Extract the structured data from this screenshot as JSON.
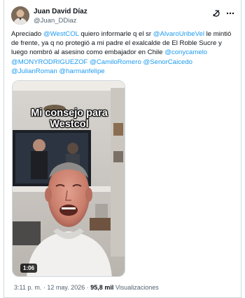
{
  "author": {
    "name": "Juan David Díaz",
    "handle": "@Juan_DDiaz"
  },
  "icons": {
    "grok": "grok-icon",
    "more": "more-options-icon"
  },
  "tweet": {
    "parts": [
      {
        "text": "Apreciado ",
        "link": false
      },
      {
        "text": "@WestCOL",
        "link": true
      },
      {
        "text": " quiero informarle q el sr ",
        "link": false
      },
      {
        "text": "@AlvaroUribeVel",
        "link": true
      },
      {
        "text": " le mintió de frente, ya q no protegió a mi padre el exalcalde de El Roble Sucre y luego nombró al asesino como  embajador en Chile ",
        "link": false
      },
      {
        "text": "@conycamelo",
        "link": true
      },
      {
        "text": " ",
        "link": false
      },
      {
        "text": "@MONYRODRIGUEZOF",
        "link": true
      },
      {
        "text": " ",
        "link": false
      },
      {
        "text": "@CamiloRomero",
        "link": true
      },
      {
        "text": " ",
        "link": false
      },
      {
        "text": "@SenorCaicedo",
        "link": true
      },
      {
        "text": " ",
        "link": false
      },
      {
        "text": "@JulianRoman",
        "link": true
      },
      {
        "text": " ",
        "link": false
      },
      {
        "text": "@harmanfelipe",
        "link": true
      }
    ]
  },
  "video": {
    "caption_line1": "Mi consejo para",
    "caption_line2": "Westcol",
    "duration": "1:06"
  },
  "meta": {
    "time": "3:11 p. m.",
    "separator": "·",
    "date": "12 may. 2026",
    "views_count": "95,8 mil",
    "views_label": "Visualizaciones"
  },
  "colors": {
    "link": "#1d9bf0",
    "text": "#0f1419",
    "secondary": "#536471"
  }
}
